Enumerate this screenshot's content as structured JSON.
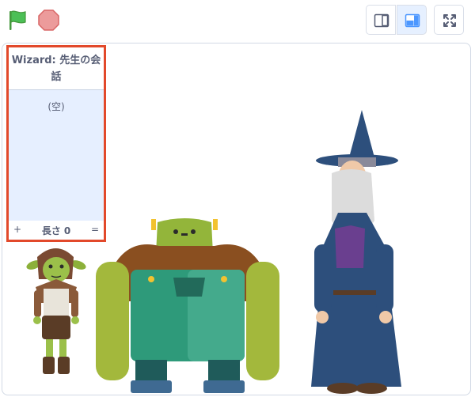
{
  "toolbar": {
    "green_flag_icon": "green-flag",
    "stop_icon": "stop-sign",
    "small_stage_icon": "small-stage",
    "large_stage_icon": "large-stage",
    "fullscreen_icon": "fullscreen-expand"
  },
  "list_monitor": {
    "title": "Wizard: 先生の会話",
    "empty_text": "(空)",
    "add_label": "+",
    "length_label": "長さ 0",
    "resize_label": "="
  },
  "colors": {
    "monitor_border": "#e2492b",
    "monitor_fill": "#e6efff",
    "flag_green": "#4cbf56",
    "stop_red": "#ec5959"
  },
  "sprites": [
    "goblin",
    "ogre",
    "wizard"
  ]
}
